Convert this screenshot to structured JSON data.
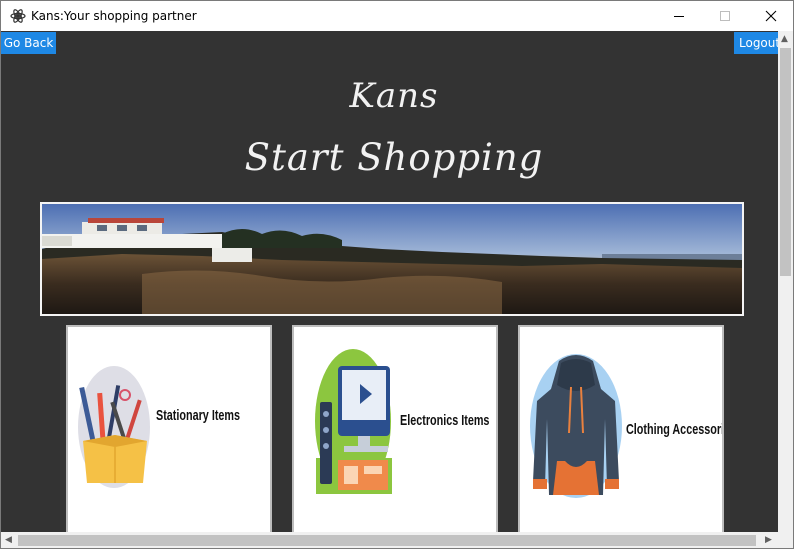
{
  "window": {
    "title": "Kans:Your shopping partner"
  },
  "nav": {
    "go_back_label": "Go Back",
    "logout_label": "Logout"
  },
  "header": {
    "brand": "Kans",
    "subtitle": "Start Shopping"
  },
  "categories": [
    {
      "label": "Stationary Items",
      "icon": "stationery-box-icon"
    },
    {
      "label": "Electronics Items",
      "icon": "electronics-icon"
    },
    {
      "label": "Clothing Accessories",
      "icon": "hoodie-icon"
    }
  ],
  "colors": {
    "background": "#333333",
    "accent": "#1e88e5",
    "heading_text": "#f2f2f2"
  }
}
